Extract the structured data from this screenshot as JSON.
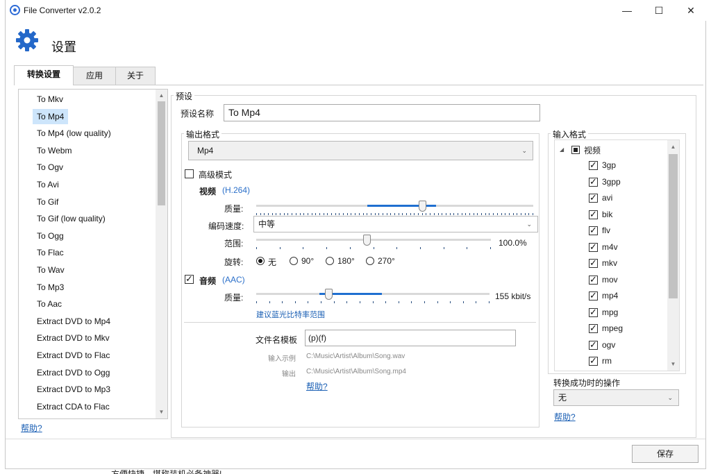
{
  "window": {
    "title": "File Converter v2.0.2",
    "minimize": "—",
    "maximize": "☐",
    "close": "✕"
  },
  "header": {
    "title": "设置"
  },
  "tabs": [
    {
      "label": "转换设置",
      "active": true
    },
    {
      "label": "应用",
      "active": false
    },
    {
      "label": "关于",
      "active": false
    }
  ],
  "presets": {
    "items": [
      "To Mkv",
      "To Mp4",
      "To Mp4 (low quality)",
      "To Webm",
      "To Ogv",
      "To Avi",
      "To Gif",
      "To Gif (low quality)",
      "To Ogg",
      "To Flac",
      "To Wav",
      "To Mp3",
      "To Aac",
      "Extract DVD to Mp4",
      "Extract DVD to Mkv",
      "Extract DVD to Flac",
      "Extract DVD to Ogg",
      "Extract DVD to Mp3",
      "Extract CDA to Flac"
    ],
    "selected_index": 1,
    "help_link": "帮助?"
  },
  "preset": {
    "group_label": "预设",
    "name_label": "预设名称",
    "name_value": "To Mp4",
    "output": {
      "group_label": "输出格式",
      "format": "Mp4",
      "advanced_mode": "高级模式",
      "video_label": "视频",
      "video_codec": "(H.264)",
      "quality_label": "质量:",
      "encoding_speed_label": "编码速度:",
      "encoding_speed": "中等",
      "scale_label": "范围:",
      "scale_value": "100.0%",
      "rotate_label": "旋转:",
      "rotate_options": [
        "无",
        "90°",
        "180°",
        "270°"
      ],
      "rotate_selected": 0,
      "audio_label": "音频",
      "audio_codec": "(AAC)",
      "audio_quality_label": "质量:",
      "audio_bitrate": "155 kbit/s",
      "bitrate_hint": "建议蓝光比特率范围",
      "video_quality_level": 0.6,
      "scale_level": 0.47,
      "audio_quality_level": 0.31
    },
    "filename": {
      "template_label": "文件名模板",
      "template_value": "(p)(f)",
      "input_example_label": "输入示例",
      "input_example": "C:\\Music\\Artist\\Album\\Song.wav",
      "output_label": "输出",
      "output_example": "C:\\Music\\Artist\\Album\\Song.mp4",
      "help_link": "帮助?"
    }
  },
  "input_formats": {
    "group_label": "输入格式",
    "category": "视频",
    "items": [
      "3gp",
      "3gpp",
      "avi",
      "bik",
      "flv",
      "m4v",
      "mkv",
      "mov",
      "mp4",
      "mpg",
      "mpeg",
      "ogv",
      "rm"
    ],
    "on_complete_label": "转换成功时的操作",
    "on_complete_value": "无",
    "help_link": "帮助?"
  },
  "footer": {
    "save": "保存",
    "cut_text": "方便快捷，堪称装机必备神器!"
  },
  "colors": {
    "accent": "#1f6fd0",
    "selection": "#cde5fb",
    "link": "#1a5fb4"
  }
}
